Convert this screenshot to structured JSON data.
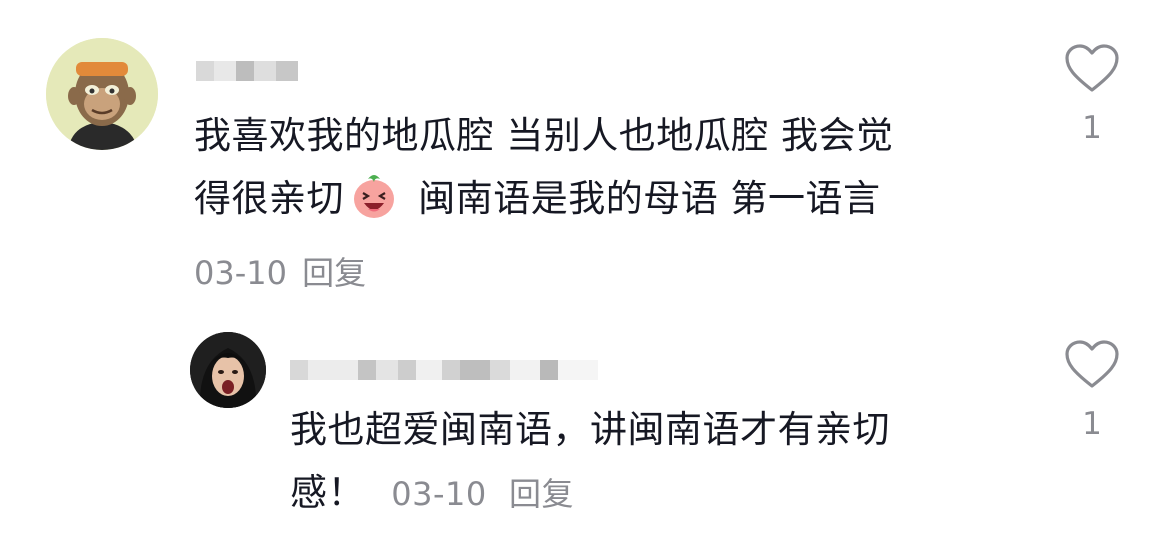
{
  "comments": [
    {
      "text_lines": [
        "我喜欢我的地瓜腔  当别人也地瓜腔 我会觉",
        "得很亲切",
        "  闽南语是我的母语  第一语言"
      ],
      "emoji": "laughing-sweet-potato-emoji",
      "date": "03-10",
      "reply_label": "回复",
      "like_count": "1"
    },
    {
      "text_lines": [
        "我也超爱闽南语，讲闽南语才有亲切",
        "感！"
      ],
      "date": "03-10",
      "reply_label": "回复",
      "like_count": "1"
    }
  ],
  "icons": {
    "like": "heart-outline-icon"
  },
  "colors": {
    "text": "#161823",
    "meta": "#8a8b91",
    "icon": "#8a8b91"
  }
}
